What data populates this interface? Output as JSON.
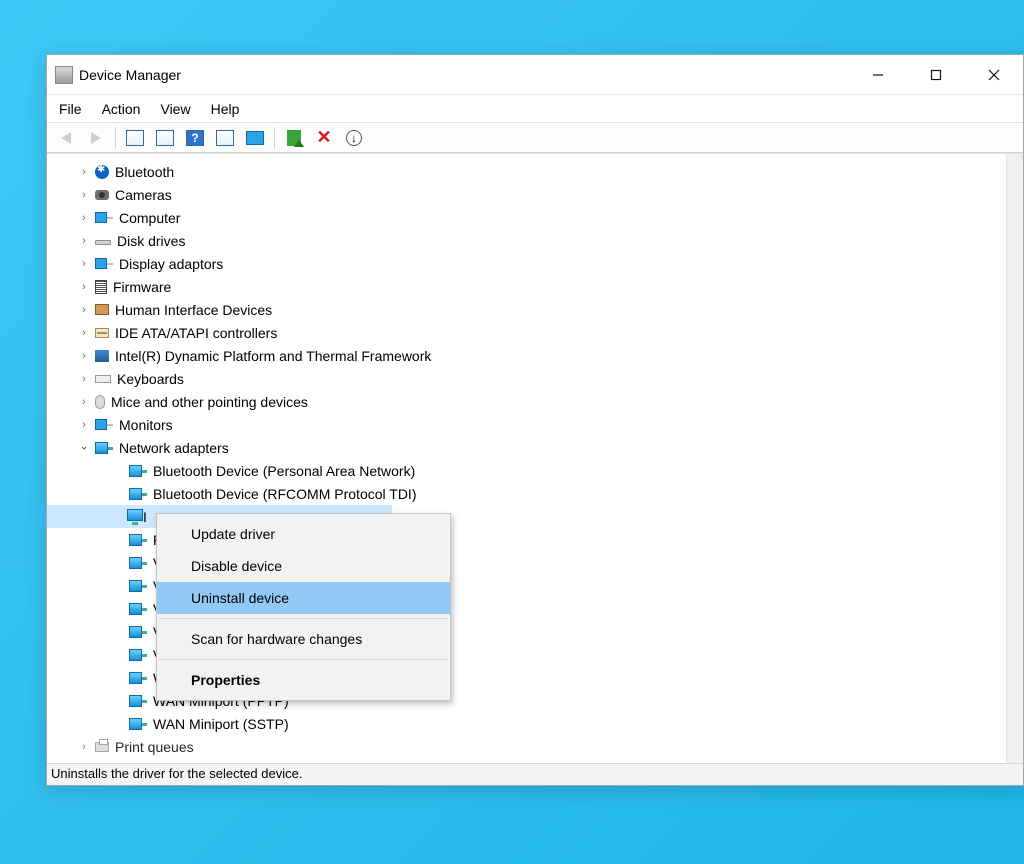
{
  "window": {
    "title": "Device Manager"
  },
  "menubar": {
    "file": "File",
    "action": "Action",
    "view": "View",
    "help": "Help"
  },
  "categories": {
    "bluetooth": "Bluetooth",
    "cameras": "Cameras",
    "computer": "Computer",
    "disk": "Disk drives",
    "display": "Display adaptors",
    "firmware": "Firmware",
    "hid": "Human Interface Devices",
    "ide": "IDE ATA/ATAPI controllers",
    "intel": "Intel(R) Dynamic Platform and Thermal Framework",
    "keyboards": "Keyboards",
    "mice": "Mice and other pointing devices",
    "monitors": "Monitors",
    "netadapters": "Network adapters",
    "printq": "Print queues"
  },
  "netchildren": {
    "c1": "Bluetooth Device (Personal Area Network)",
    "c2": "Bluetooth Device (RFCOMM Protocol TDI)",
    "c3": "I",
    "c4": "F",
    "c5": "V",
    "c6": "V",
    "c7": "V",
    "c8": "V",
    "c9": "V",
    "c10": "WAN Miniport (PPPOE)",
    "c11": "WAN Miniport (PPTP)",
    "c12": "WAN Miniport (SSTP)"
  },
  "context": {
    "update": "Update driver",
    "disable": "Disable device",
    "uninstall": "Uninstall device",
    "scan": "Scan for hardware changes",
    "properties": "Properties"
  },
  "status": "Uninstalls the driver for the selected device."
}
